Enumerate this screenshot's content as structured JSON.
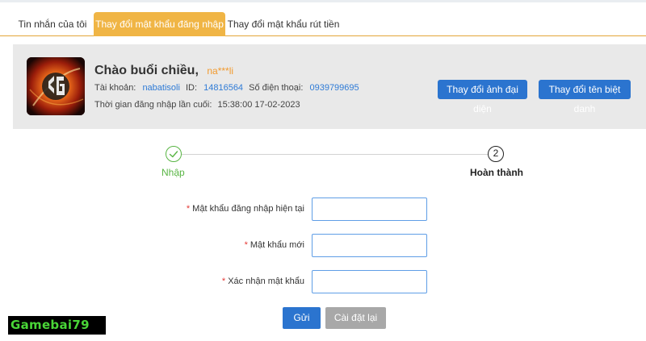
{
  "tabs": [
    {
      "label": "Tin nhắn của tôi",
      "active": false
    },
    {
      "label": "Thay đổi mật khẩu đăng nhập",
      "active": true
    },
    {
      "label": "Thay đổi mật khẩu rút tiền",
      "active": false
    }
  ],
  "profile": {
    "greeting": "Chào buổi chiều,",
    "name": "na***li",
    "account_label": "Tài khoản:",
    "account_value": "nabatisoli",
    "id_label": "ID:",
    "id_value": "14816564",
    "phone_label": "Số điện thoại:",
    "phone_value": "0939799695",
    "last_login_label": "Thời gian đăng nhập lần cuối:",
    "last_login_value": "15:38:00 17-02-2023",
    "change_avatar_label": "Thay đổi ảnh đại diện",
    "change_nickname_label": "Thay đổi tên biệt danh",
    "avatar_icon": "gaming-logo-icon"
  },
  "steps": [
    {
      "label": "Nhập",
      "status": "done",
      "icon": "check-icon"
    },
    {
      "label": "Hoàn thành",
      "status": "current",
      "number": "2"
    }
  ],
  "form": {
    "required_mark": "*",
    "current_password_label": "Mật khẩu đăng nhập hiện tại",
    "current_password_value": "",
    "new_password_label": "Mật khẩu mới",
    "new_password_value": "",
    "confirm_password_label": "Xác nhận mật khẩu",
    "confirm_password_value": "",
    "submit_label": "Gửi",
    "reset_label": "Cài đặt lại"
  },
  "watermark": {
    "text": "Gamebai79"
  },
  "colors": {
    "active_tab": "#f0b545",
    "primary_button": "#2b74cf",
    "link_blue": "#2f7bd6",
    "name_orange": "#f29a2e",
    "step_done_green": "#59b544",
    "required_red": "#e53935",
    "watermark_green": "#49d637"
  }
}
